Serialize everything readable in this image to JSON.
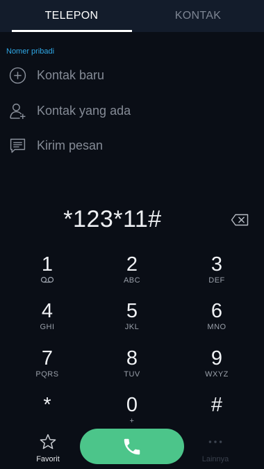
{
  "tabs": {
    "telepon": "TELEPON",
    "kontak": "KONTAK"
  },
  "section": {
    "label": "Nomer pribadi"
  },
  "menu": {
    "new_contact": {
      "label": "Kontak baru",
      "icon": "add-circle-icon"
    },
    "existing_contact": {
      "label": "Kontak yang ada",
      "icon": "add-person-icon"
    },
    "send_message": {
      "label": "Kirim pesan",
      "icon": "message-icon"
    }
  },
  "dialer": {
    "number": "*123*11#",
    "backspace_icon": "backspace-icon"
  },
  "keypad": [
    {
      "digit": "1",
      "sub": ""
    },
    {
      "digit": "2",
      "sub": "ABC"
    },
    {
      "digit": "3",
      "sub": "DEF"
    },
    {
      "digit": "4",
      "sub": "GHI"
    },
    {
      "digit": "5",
      "sub": "JKL"
    },
    {
      "digit": "6",
      "sub": "MNO"
    },
    {
      "digit": "7",
      "sub": "PQRS"
    },
    {
      "digit": "8",
      "sub": "TUV"
    },
    {
      "digit": "9",
      "sub": "WXYZ"
    },
    {
      "digit": "*",
      "sub": ""
    },
    {
      "digit": "0",
      "sub": "+"
    },
    {
      "digit": "#",
      "sub": ""
    }
  ],
  "bottom": {
    "favorit": "Favorit",
    "lainnya": "Lainnya",
    "call_icon": "phone-icon"
  },
  "colors": {
    "background": "#0a0e16",
    "tabbar": "#131c2b",
    "accent": "#2fa8e6",
    "call": "#4cc58a"
  }
}
